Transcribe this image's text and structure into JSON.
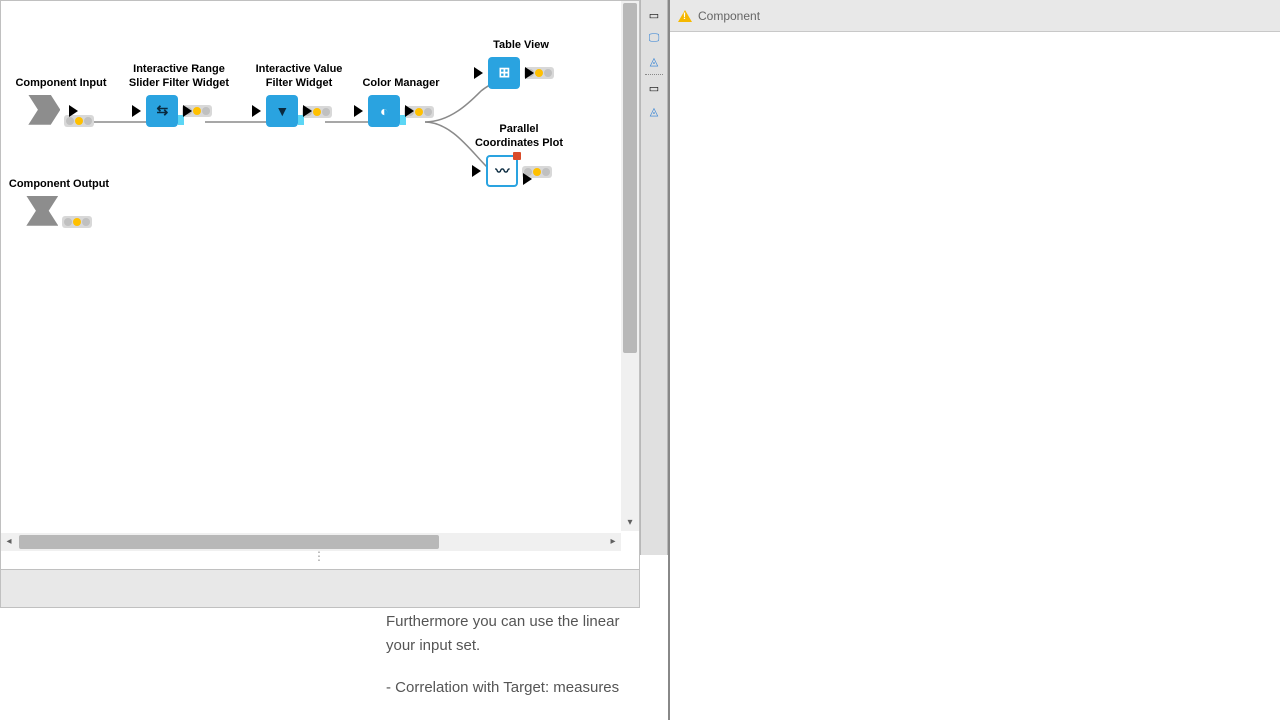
{
  "right_panel": {
    "title": "Component"
  },
  "nodes": {
    "component_input": {
      "label": "Component Input"
    },
    "range_slider": {
      "label": "Interactive Range\nSlider Filter Widget"
    },
    "value_filter": {
      "label": "Interactive Value\nFilter Widget"
    },
    "color_manager": {
      "label": "Color Manager"
    },
    "table_view": {
      "label": "Table View"
    },
    "parallel_coords": {
      "label": "Parallel\nCoordinates Plot"
    },
    "component_output": {
      "label": "Component Output"
    }
  },
  "description": {
    "line1": "Furthermore you can use the linear ",
    "line2": "your input set.",
    "line3": "- Correlation with Target: measures "
  },
  "toolbar_icons": {
    "window1": "window-icon",
    "monitor": "monitor-icon",
    "triangle_info": "triangle-info-icon",
    "window2": "window-icon",
    "triangle_help": "triangle-help-icon"
  }
}
